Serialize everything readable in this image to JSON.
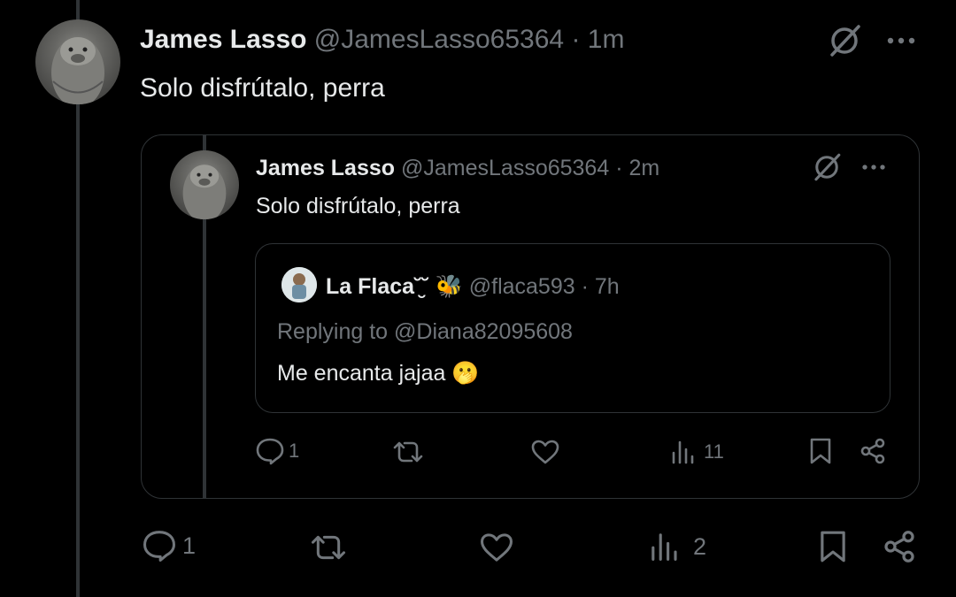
{
  "main_tweet": {
    "display_name": "James Lasso",
    "handle": "@JamesLasso65364",
    "separator": "·",
    "time": "1m",
    "text": "Solo disfrútalo, perra",
    "actions": {
      "replies": "1",
      "views": "2"
    }
  },
  "quoted_tweet": {
    "display_name": "James Lasso",
    "handle": "@JamesLasso65364",
    "separator": "·",
    "time": "2m",
    "text": "Solo disfrútalo, perra",
    "actions": {
      "replies": "1",
      "views": "11"
    }
  },
  "nested_quote": {
    "display_name": "La Flaca˘̮˘",
    "emoji": "🐝",
    "handle": "@flaca593",
    "separator": "·",
    "time": "7h",
    "replying_to_prefix": "Replying to",
    "replying_to_handle": "@Diana82095608",
    "text": "Me encanta jajaa",
    "text_emoji": "🫢"
  },
  "colors": {
    "background": "#000000",
    "text": "#e7e9ea",
    "muted": "#71767b",
    "border": "#2f3336",
    "emoji_yellow": "#f5b93a"
  }
}
